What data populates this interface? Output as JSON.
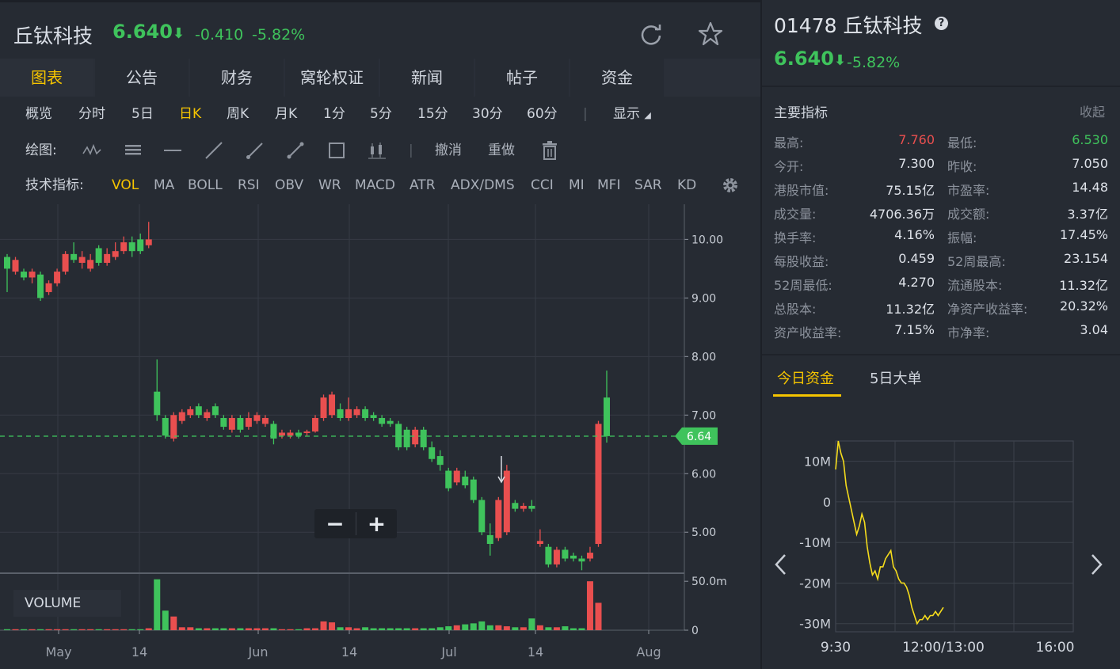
{
  "header": {
    "name": "丘钛科技",
    "price": "6.640",
    "change": "-0.410",
    "change_pct": "-5.82%",
    "arrow": "⬇"
  },
  "tabs": [
    "图表",
    "公告",
    "财务",
    "窝轮权证",
    "新闻",
    "帖子",
    "资金"
  ],
  "periods": [
    "概览",
    "分时",
    "5日",
    "日K",
    "周K",
    "月K",
    "1分",
    "5分",
    "15分",
    "30分",
    "60分"
  ],
  "display_label": "显示",
  "draw_label": "绘图:",
  "undo": "撤消",
  "redo": "重做",
  "ind_label": "技术指标:",
  "indicators": [
    "VOL",
    "MA",
    "BOLL",
    "RSI",
    "OBV",
    "WR",
    "MACD",
    "ATR",
    "ADX/DMS",
    "CCI",
    "MI",
    "MFI",
    "SAR",
    "KD"
  ],
  "volume_label": "VOLUME",
  "chart_data": {
    "type": "candlestick",
    "y_ticks": [
      "10.00",
      "9.00",
      "8.00",
      "7.00",
      "6.00",
      "5.00"
    ],
    "y_range": [
      4.3,
      10.6
    ],
    "current_price_label": "6.64",
    "current_price": 6.64,
    "vol_ticks": [
      "50.0m",
      "0"
    ],
    "vol_range": [
      0,
      55
    ],
    "x_labels": [
      "May",
      "14",
      "Jun",
      "14",
      "Jul",
      "14",
      "Aug"
    ],
    "candles": [
      {
        "o": 9.7,
        "c": 9.5,
        "h": 9.75,
        "l": 9.1
      },
      {
        "o": 9.45,
        "c": 9.65,
        "h": 9.7,
        "l": 9.4
      },
      {
        "o": 9.45,
        "c": 9.35,
        "h": 9.5,
        "l": 9.3
      },
      {
        "o": 9.35,
        "c": 9.45,
        "h": 9.5,
        "l": 9.25
      },
      {
        "o": 9.4,
        "c": 9.0,
        "h": 9.45,
        "l": 8.95
      },
      {
        "o": 9.1,
        "c": 9.25,
        "h": 9.3,
        "l": 9.05
      },
      {
        "o": 9.25,
        "c": 9.45,
        "h": 9.5,
        "l": 9.2
      },
      {
        "o": 9.45,
        "c": 9.75,
        "h": 9.8,
        "l": 9.4
      },
      {
        "o": 9.75,
        "c": 9.65,
        "h": 9.95,
        "l": 9.6
      },
      {
        "o": 9.6,
        "c": 9.7,
        "h": 9.8,
        "l": 9.5
      },
      {
        "o": 9.5,
        "c": 9.65,
        "h": 9.75,
        "l": 9.45
      },
      {
        "o": 9.85,
        "c": 9.6,
        "h": 9.9,
        "l": 9.55
      },
      {
        "o": 9.6,
        "c": 9.75,
        "h": 9.85,
        "l": 9.55
      },
      {
        "o": 9.7,
        "c": 9.8,
        "h": 9.95,
        "l": 9.65
      },
      {
        "o": 9.8,
        "c": 9.95,
        "h": 10.05,
        "l": 9.75
      },
      {
        "o": 9.95,
        "c": 9.8,
        "h": 10.05,
        "l": 9.7
      },
      {
        "o": 10.0,
        "c": 9.8,
        "h": 10.1,
        "l": 9.75
      },
      {
        "o": 9.9,
        "c": 10.0,
        "h": 10.3,
        "l": 9.85
      },
      {
        "o": 7.4,
        "c": 7.0,
        "h": 7.95,
        "l": 6.9
      },
      {
        "o": 6.95,
        "c": 6.65,
        "h": 7.0,
        "l": 6.6
      },
      {
        "o": 6.6,
        "c": 7.0,
        "h": 7.05,
        "l": 6.55
      },
      {
        "o": 6.9,
        "c": 7.05,
        "h": 7.1,
        "l": 6.85
      },
      {
        "o": 7.0,
        "c": 7.1,
        "h": 7.15,
        "l": 6.95
      },
      {
        "o": 7.15,
        "c": 7.0,
        "h": 7.2,
        "l": 6.95
      },
      {
        "o": 6.95,
        "c": 7.05,
        "h": 7.1,
        "l": 6.9
      },
      {
        "o": 7.15,
        "c": 7.0,
        "h": 7.2,
        "l": 6.95
      },
      {
        "o": 6.95,
        "c": 6.8,
        "h": 7.0,
        "l": 6.75
      },
      {
        "o": 6.75,
        "c": 6.95,
        "h": 7.0,
        "l": 6.7
      },
      {
        "o": 6.95,
        "c": 6.75,
        "h": 7.0,
        "l": 6.7
      },
      {
        "o": 6.8,
        "c": 6.95,
        "h": 7.05,
        "l": 6.75
      },
      {
        "o": 6.9,
        "c": 7.0,
        "h": 7.05,
        "l": 6.85
      },
      {
        "o": 6.85,
        "c": 6.95,
        "h": 7.0,
        "l": 6.8
      },
      {
        "o": 6.85,
        "c": 6.6,
        "h": 6.9,
        "l": 6.5
      },
      {
        "o": 6.65,
        "c": 6.7,
        "h": 6.75,
        "l": 6.6
      },
      {
        "o": 6.65,
        "c": 6.7,
        "h": 6.75,
        "l": 6.6
      },
      {
        "o": 6.7,
        "c": 6.65,
        "h": 6.75,
        "l": 6.6
      },
      {
        "o": 6.7,
        "c": 6.72,
        "h": 6.75,
        "l": 6.65
      },
      {
        "o": 6.72,
        "c": 6.95,
        "h": 7.0,
        "l": 6.7
      },
      {
        "o": 6.95,
        "c": 7.3,
        "h": 7.35,
        "l": 6.9
      },
      {
        "o": 7.0,
        "c": 7.35,
        "h": 7.4,
        "l": 6.95
      },
      {
        "o": 7.1,
        "c": 6.95,
        "h": 7.2,
        "l": 6.9
      },
      {
        "o": 6.95,
        "c": 7.1,
        "h": 7.3,
        "l": 6.9
      },
      {
        "o": 7.0,
        "c": 7.1,
        "h": 7.15,
        "l": 6.95
      },
      {
        "o": 7.1,
        "c": 6.95,
        "h": 7.15,
        "l": 6.9
      },
      {
        "o": 7.0,
        "c": 6.95,
        "h": 7.05,
        "l": 6.9
      },
      {
        "o": 6.95,
        "c": 6.85,
        "h": 7.0,
        "l": 6.8
      },
      {
        "o": 6.9,
        "c": 6.85,
        "h": 6.95,
        "l": 6.8
      },
      {
        "o": 6.85,
        "c": 6.45,
        "h": 6.9,
        "l": 6.4
      },
      {
        "o": 6.75,
        "c": 6.45,
        "h": 6.8,
        "l": 6.4
      },
      {
        "o": 6.5,
        "c": 6.75,
        "h": 6.8,
        "l": 6.45
      },
      {
        "o": 6.75,
        "c": 6.45,
        "h": 6.8,
        "l": 6.4
      },
      {
        "o": 6.45,
        "c": 6.25,
        "h": 6.55,
        "l": 6.2
      },
      {
        "o": 6.3,
        "c": 6.15,
        "h": 6.4,
        "l": 6.05
      },
      {
        "o": 6.05,
        "c": 5.75,
        "h": 6.1,
        "l": 5.7
      },
      {
        "o": 5.85,
        "c": 6.05,
        "h": 6.1,
        "l": 5.8
      },
      {
        "o": 5.95,
        "c": 5.8,
        "h": 6.05,
        "l": 5.75
      },
      {
        "o": 5.9,
        "c": 5.55,
        "h": 5.95,
        "l": 5.5
      },
      {
        "o": 5.55,
        "c": 5.0,
        "h": 5.6,
        "l": 4.95
      },
      {
        "o": 4.95,
        "c": 4.8,
        "h": 5.15,
        "l": 4.6
      },
      {
        "o": 4.9,
        "c": 5.55,
        "h": 5.6,
        "l": 4.85
      },
      {
        "o": 5.0,
        "c": 6.05,
        "h": 6.15,
        "l": 4.95
      },
      {
        "o": 5.5,
        "c": 5.4,
        "h": 5.55,
        "l": 5.35
      },
      {
        "o": 5.4,
        "c": 5.45,
        "h": 5.5,
        "l": 5.35
      },
      {
        "o": 5.45,
        "c": 5.4,
        "h": 5.55,
        "l": 5.35
      },
      {
        "o": 4.8,
        "c": 4.85,
        "h": 5.05,
        "l": 4.75
      },
      {
        "o": 4.75,
        "c": 4.45,
        "h": 4.8,
        "l": 4.4
      },
      {
        "o": 4.45,
        "c": 4.7,
        "h": 4.75,
        "l": 4.4
      },
      {
        "o": 4.7,
        "c": 4.55,
        "h": 4.75,
        "l": 4.5
      },
      {
        "o": 4.6,
        "c": 4.55,
        "h": 4.65,
        "l": 4.5
      },
      {
        "o": 4.55,
        "c": 4.5,
        "h": 4.6,
        "l": 4.35
      },
      {
        "o": 4.55,
        "c": 4.65,
        "h": 4.75,
        "l": 4.5
      },
      {
        "o": 4.8,
        "c": 6.85,
        "h": 6.9,
        "l": 4.75
      },
      {
        "o": 7.3,
        "c": 6.64,
        "h": 7.76,
        "l": 6.53
      }
    ],
    "volume": [
      1,
      1,
      1,
      1,
      1,
      1,
      1,
      1,
      1,
      1,
      1,
      1,
      1,
      1,
      1,
      1,
      1,
      2,
      52,
      20,
      14,
      3,
      3,
      2,
      2,
      2,
      2,
      2,
      2,
      2,
      2,
      2,
      2,
      1,
      1,
      1,
      2,
      2,
      9,
      8,
      3,
      3,
      2,
      3,
      2,
      2,
      2,
      2,
      2,
      2,
      2,
      2,
      3,
      4,
      5,
      6,
      7,
      9,
      5,
      5,
      4,
      3,
      3,
      12,
      5,
      3,
      3,
      4,
      2,
      2,
      50,
      28
    ],
    "events": [
      "2020-05-14",
      "2020-06-14",
      "2020-07-14"
    ]
  },
  "info": {
    "code": "01478",
    "name": "丘钛科技",
    "price": "6.640",
    "arrow": "⬇",
    "pct": "-5.82%",
    "section_title": "主要指标",
    "collapse": "收起",
    "metrics": [
      {
        "l1": "最高:",
        "v1": "7.760",
        "c1": "up",
        "l2": "最低:",
        "v2": "6.530",
        "c2": "down"
      },
      {
        "l1": "今开:",
        "v1": "7.300",
        "c1": "",
        "l2": "昨收:",
        "v2": "7.050",
        "c2": ""
      },
      {
        "l1": "港股市值:",
        "v1": "75.15亿",
        "c1": "",
        "l2": "市盈率:",
        "v2": "14.48",
        "c2": ""
      },
      {
        "l1": "成交量:",
        "v1": "4706.36万",
        "c1": "",
        "l2": "成交额:",
        "v2": "3.37亿",
        "c2": ""
      },
      {
        "l1": "换手率:",
        "v1": "4.16%",
        "c1": "",
        "l2": "振幅:",
        "v2": "17.45%",
        "c2": ""
      },
      {
        "l1": "每股收益:",
        "v1": "0.459",
        "c1": "",
        "l2": "52周最高:",
        "v2": "23.154",
        "c2": ""
      },
      {
        "l1": "52周最低:",
        "v1": "4.270",
        "c1": "",
        "l2": "流通股本:",
        "v2": "11.32亿",
        "c2": ""
      },
      {
        "l1": "总股本:",
        "v1": "11.32亿",
        "c1": "",
        "l2": "净资产收益率:",
        "v2": "20.32%",
        "c2": ""
      },
      {
        "l1": "资产收益率:",
        "v1": "7.15%",
        "c1": "",
        "l2": "市净率:",
        "v2": "3.04",
        "c2": ""
      }
    ],
    "fund_tabs": [
      "今日资金",
      "5日大单"
    ]
  },
  "fund_chart": {
    "type": "line",
    "y_ticks": [
      "10M",
      "0",
      "-10M",
      "-20M",
      "-30M"
    ],
    "y_range": [
      -32,
      15
    ],
    "x_labels": [
      "9:30",
      "12:00/13:00",
      "16:00"
    ],
    "values": [
      8,
      15,
      12,
      10,
      4,
      1,
      -2,
      -5,
      -8,
      -6,
      -3,
      -5,
      -11,
      -15,
      -18,
      -17,
      -19,
      -16,
      -16,
      -14,
      -13,
      -12,
      -16,
      -17,
      -19,
      -20,
      -20,
      -21,
      -23,
      -26,
      -28,
      -30,
      -29,
      -29,
      -28,
      -29,
      -28,
      -28,
      -27,
      -28,
      -27,
      -26
    ]
  },
  "colors": {
    "up": "#e94f4f",
    "down": "#3fc35c",
    "accent": "#f5c400",
    "line": "#f5dc1c"
  }
}
